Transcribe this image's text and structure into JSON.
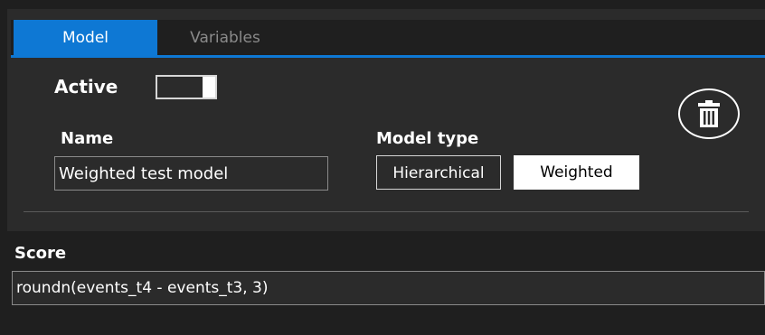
{
  "tabs": [
    {
      "label": "Model",
      "selected": true
    },
    {
      "label": "Variables",
      "selected": false
    }
  ],
  "model": {
    "active_label": "Active",
    "active_on": true,
    "delete_icon": "trash-icon",
    "name_label": "Name",
    "name_value": "Weighted test model",
    "type_label": "Model type",
    "type_options": [
      "Hierarchical",
      "Weighted"
    ],
    "type_selected": "Weighted"
  },
  "score": {
    "label": "Score",
    "value": "roundn(events_t4 - events_t3, 3)"
  },
  "colors": {
    "accent": "#0e78d4",
    "background": "#1f1f1f",
    "panel": "#2b2b2b"
  }
}
